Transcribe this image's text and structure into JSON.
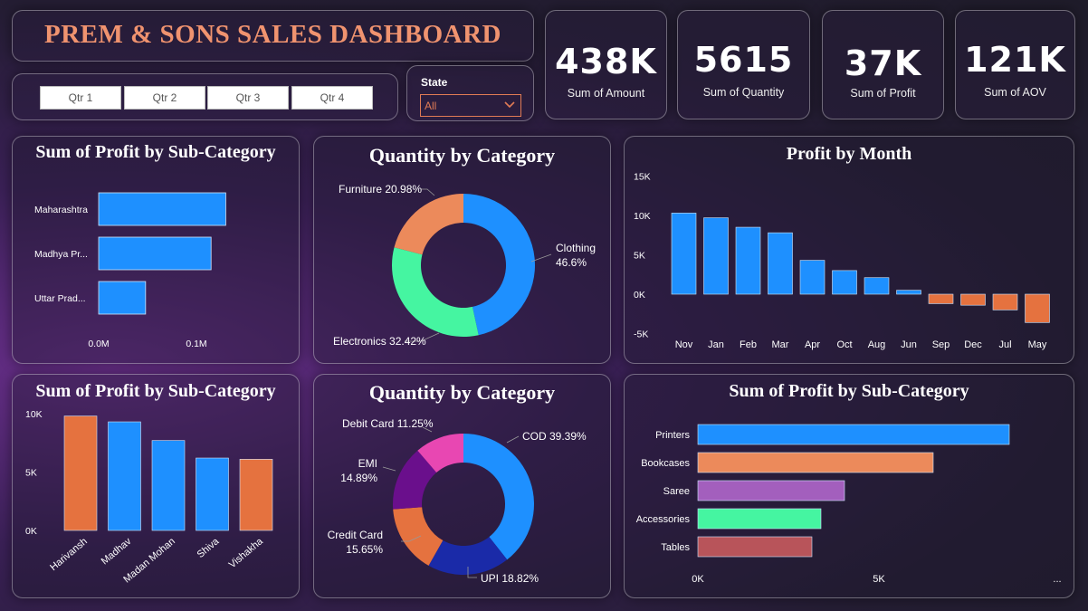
{
  "header": {
    "title": "PREM & SONS SALES DASHBOARD"
  },
  "filters": {
    "quarters": [
      "Qtr 1",
      "Qtr 2",
      "Qtr 3",
      "Qtr 4"
    ],
    "state_label": "State",
    "state_value": "All"
  },
  "kpis": [
    {
      "value": "438K",
      "label": "Sum of Amount"
    },
    {
      "value": "5615",
      "label": "Sum of Quantity"
    },
    {
      "value": "37K",
      "label": "Sum of Profit"
    },
    {
      "value": "121K",
      "label": "Sum of AOV"
    }
  ],
  "colors": {
    "blue": "#1e90ff",
    "orange": "#e5723f",
    "title": "#f0936f"
  },
  "chart_data": [
    {
      "type": "bar",
      "orientation": "horizontal",
      "title": "Sum of Profit by Sub-Category",
      "categories": [
        "Maharashtra",
        "Madhya Pr...",
        "Uttar Prad..."
      ],
      "values": [
        0.13,
        0.115,
        0.048
      ],
      "xticks": [
        "0.0M",
        "0.1M"
      ],
      "xtick_values": [
        0,
        0.1
      ],
      "color": "#1e90ff"
    },
    {
      "type": "pie",
      "donut": true,
      "title": "Quantity by Category",
      "slices": [
        {
          "label": "Clothing",
          "value": 46.6,
          "display": "46.6%",
          "color": "#1e90ff"
        },
        {
          "label": "Electronics",
          "value": 32.42,
          "display": "32.42%",
          "color": "#45f5a1"
        },
        {
          "label": "Furniture",
          "value": 20.98,
          "display": "20.98%",
          "color": "#ec8a5b"
        }
      ]
    },
    {
      "type": "bar",
      "title": "Profit by Month",
      "categories": [
        "Nov",
        "Jan",
        "Feb",
        "Mar",
        "Apr",
        "Oct",
        "Aug",
        "Jun",
        "Sep",
        "Dec",
        "Jul",
        "May"
      ],
      "values": [
        10300,
        9700,
        8500,
        7800,
        4300,
        3000,
        2100,
        500,
        -1200,
        -1400,
        -2000,
        -3600
      ],
      "yticks": [
        "15K",
        "10K",
        "5K",
        "0K",
        "-5K"
      ],
      "ytick_values": [
        15000,
        10000,
        5000,
        0,
        -5000
      ],
      "ylim": [
        -5000,
        15000
      ],
      "positive_color": "#1e90ff",
      "negative_color": "#e5723f"
    },
    {
      "type": "bar",
      "title": "Sum of Profit by Sub-Category",
      "categories": [
        "Harivansh",
        "Madhav",
        "Madan Mohan",
        "Shiva",
        "Vishakha"
      ],
      "values": [
        9800,
        9300,
        7700,
        6200,
        6100
      ],
      "colors": [
        "#e5723f",
        "#1e90ff",
        "#1e90ff",
        "#1e90ff",
        "#e5723f"
      ],
      "yticks": [
        "10K",
        "5K",
        "0K"
      ],
      "ytick_values": [
        10000,
        5000,
        0
      ],
      "ylim": [
        0,
        10000
      ]
    },
    {
      "type": "pie",
      "donut": true,
      "title": "Quantity by Category",
      "slices": [
        {
          "label": "COD",
          "value": 39.39,
          "display": "39.39%",
          "color": "#1e90ff"
        },
        {
          "label": "UPI",
          "value": 18.82,
          "display": "18.82%",
          "color": "#1a2aa8"
        },
        {
          "label": "Credit Card",
          "value": 15.65,
          "display": "15.65%",
          "color": "#e5723f"
        },
        {
          "label": "EMI",
          "value": 14.89,
          "display": "14.89%",
          "color": "#6a0f8c"
        },
        {
          "label": "Debit Card",
          "value": 11.25,
          "display": "11.25%",
          "color": "#e847b2"
        }
      ]
    },
    {
      "type": "bar",
      "orientation": "horizontal",
      "title": "Sum of Profit by Sub-Category",
      "categories": [
        "Printers",
        "Bookcases",
        "Saree",
        "Accessories",
        "Tables"
      ],
      "values": [
        8600,
        6500,
        4050,
        3400,
        3150
      ],
      "colors": [
        "#1e90ff",
        "#ec8a5b",
        "#a35fbd",
        "#45f5a1",
        "#b8545a"
      ],
      "xticks": [
        "0K",
        "5K",
        "..."
      ],
      "xtick_values": [
        0,
        5000
      ]
    }
  ]
}
